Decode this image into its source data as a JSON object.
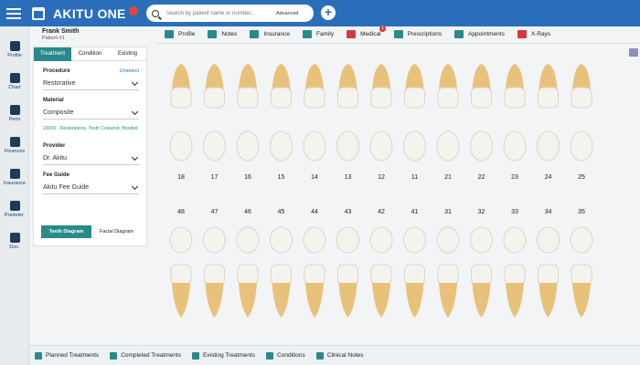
{
  "app": {
    "brand": "AKITU ONE"
  },
  "search": {
    "placeholder": "Search by patient name or number...",
    "advanced": "Advanced"
  },
  "nav": [
    {
      "label": "Profile"
    },
    {
      "label": "Chart"
    },
    {
      "label": "Perio"
    },
    {
      "label": "Finances"
    },
    {
      "label": "Insurance"
    },
    {
      "label": "Predeter."
    },
    {
      "label": "Doc."
    }
  ],
  "patient": {
    "name": "Frank Smith",
    "number": "Patient #1"
  },
  "panel": {
    "tabs": [
      "Treatment",
      "Condition",
      "Existing"
    ],
    "procedure_label": "Procedure",
    "unselect": "Unselect",
    "procedure_value": "Restorative",
    "material_label": "Material",
    "material_value": "Composite",
    "description": "2300X - Restorations, Tooth Coloured, Bonded",
    "provider_label": "Provider",
    "provider_value": "Dr. Akitu",
    "fee_guide_label": "Fee Guide",
    "fee_guide_value": "Akitu Fee Guide",
    "view_tabs": [
      "Teeth Diagram",
      "Facial Diagram"
    ]
  },
  "topnav": [
    {
      "label": "Profile"
    },
    {
      "label": "Notes"
    },
    {
      "label": "Insurance"
    },
    {
      "label": "Family"
    },
    {
      "label": "Medical",
      "badge": "1"
    },
    {
      "label": "Prescriptions"
    },
    {
      "label": "Appointments"
    },
    {
      "label": "X-Rays"
    }
  ],
  "upper_teeth": [
    "18",
    "17",
    "16",
    "15",
    "14",
    "13",
    "12",
    "11",
    "21",
    "22",
    "23",
    "24",
    "25"
  ],
  "lower_teeth": [
    "48",
    "47",
    "46",
    "45",
    "44",
    "43",
    "42",
    "41",
    "31",
    "32",
    "33",
    "34",
    "35"
  ],
  "bottom": [
    {
      "label": "Planned Treatments"
    },
    {
      "label": "Completed Treatments"
    },
    {
      "label": "Existing Treatments"
    },
    {
      "label": "Conditions"
    },
    {
      "label": "Clinical Notes"
    }
  ],
  "colors": {
    "header": "#2a6ebb",
    "teal": "#2a8a8a",
    "tooth": "#f5f3ee",
    "root": "#e8c27a"
  }
}
